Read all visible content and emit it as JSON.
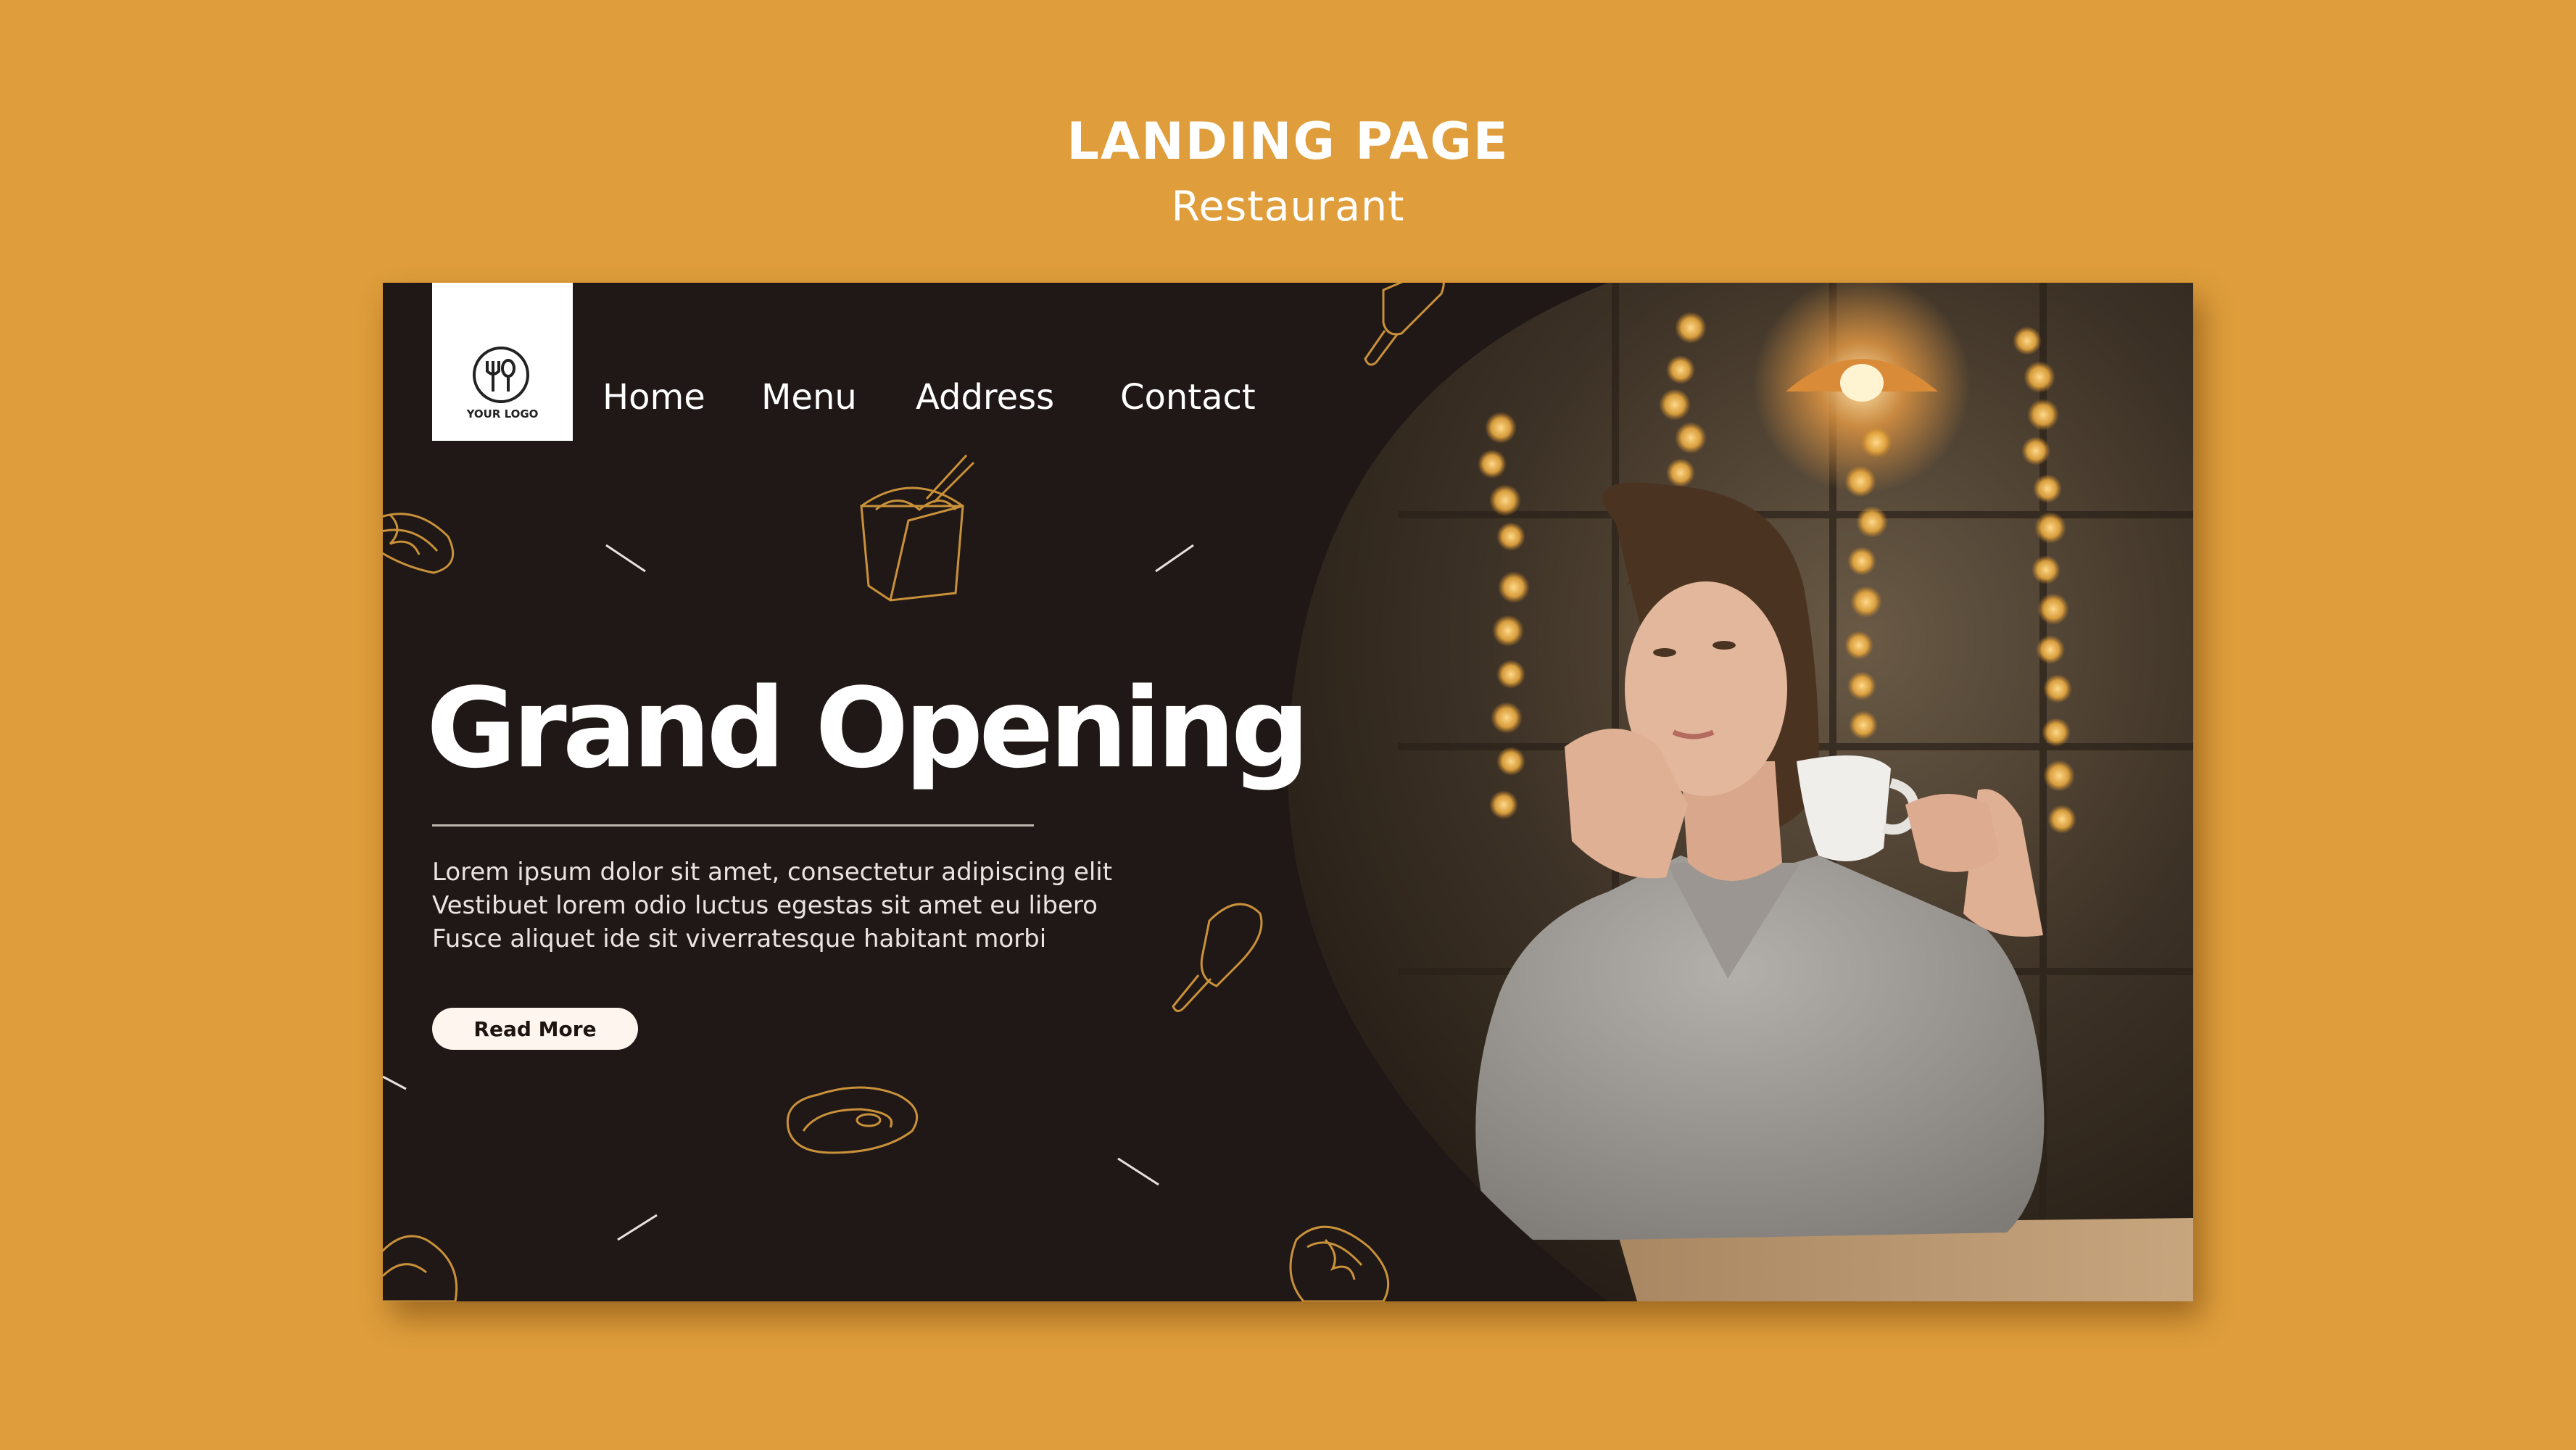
{
  "header": {
    "title": "LANDING PAGE",
    "subtitle": "Restaurant"
  },
  "logo": {
    "text": "YOUR LOGO"
  },
  "nav": {
    "home": "Home",
    "menu": "Menu",
    "address": "Address",
    "contact": "Contact"
  },
  "hero": {
    "title": "Grand Opening",
    "body": [
      "Lorem ipsum dolor sit amet, consectetur adipiscing elit",
      "Vestibuet lorem odio luctus egestas sit amet eu libero",
      "Fusce aliquet ide sit viverratesque habitant morbi"
    ],
    "button": "Read More"
  },
  "icons": {
    "logo": "fork-spoon-logo-icon",
    "decor": [
      "ice-cream-icon",
      "noodle-box-icon",
      "hotdog-icon",
      "steak-icon"
    ]
  },
  "colors": {
    "background": "#DF9E3B",
    "card": "#201816",
    "accent": "#C9913A",
    "button": "#FDF5EE"
  }
}
